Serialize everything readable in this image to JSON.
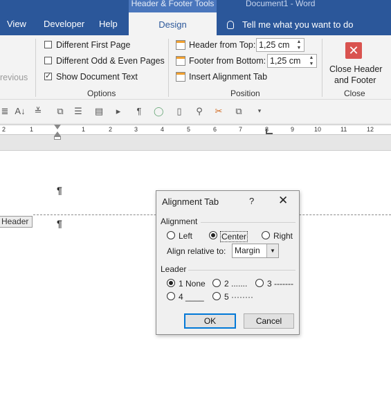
{
  "titlebar": {
    "context_tab": "Header & Footer Tools",
    "doc_title": "Document1  -  Word"
  },
  "tabs": {
    "view": "View",
    "developer": "Developer",
    "help": "Help",
    "design": "Design",
    "tell_me": "Tell me what you want to do"
  },
  "ribbon": {
    "previous_label": "revious",
    "options": {
      "diff_first_page": "Different First Page",
      "diff_odd_even": "Different Odd & Even Pages",
      "show_doc_text": "Show Document Text",
      "group_label": "Options",
      "diff_first_checked": false,
      "diff_odd_checked": false,
      "show_doc_checked": true
    },
    "position": {
      "header_from_top_label": "Header from Top:",
      "header_from_top_value": "1,25 cm",
      "footer_from_bottom_label": "Footer from Bottom:",
      "footer_from_bottom_value": "1,25 cm",
      "insert_tab_label": "Insert Alignment Tab",
      "group_label": "Position"
    },
    "close": {
      "line1": "Close Header",
      "line2": "and Footer",
      "group_label": "Close"
    }
  },
  "ruler": {
    "ticks": [
      "2",
      "1",
      "1",
      "2",
      "3",
      "4",
      "5",
      "6",
      "7",
      "8",
      "9",
      "10",
      "11",
      "12"
    ]
  },
  "document": {
    "pilcrow": "¶",
    "header_tag": "Header"
  },
  "dialog": {
    "title": "Alignment Tab",
    "help": "?",
    "close": "✕",
    "alignment": {
      "section": "Alignment",
      "left": "Left",
      "center": "Center",
      "right": "Right",
      "selected": "Center",
      "relative_label": "Align relative to:",
      "relative_value": "Margin"
    },
    "leader": {
      "section": "Leader",
      "opt1": "1 None",
      "opt2": "2 .......",
      "opt3": "3 -------",
      "opt4": "4 ____",
      "opt5": "5 ········",
      "selected": "1 None"
    },
    "ok": "OK",
    "cancel": "Cancel"
  }
}
